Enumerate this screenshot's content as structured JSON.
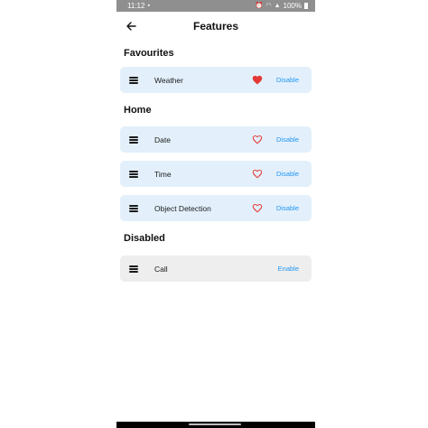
{
  "status_bar": {
    "time": "11:12",
    "battery_text": "100%"
  },
  "app_bar": {
    "title": "Features"
  },
  "colors": {
    "accent": "#2196f3",
    "heart": "#e53935",
    "card_enabled": "#e3f0fb",
    "card_disabled": "#eeeeee"
  },
  "sections": {
    "favourites": {
      "title": "Favourites",
      "items": [
        {
          "label": "Weather",
          "favourite": true,
          "action": "Disable"
        }
      ]
    },
    "home": {
      "title": "Home",
      "items": [
        {
          "label": "Date",
          "favourite": false,
          "action": "Disable"
        },
        {
          "label": "Time",
          "favourite": false,
          "action": "Disable"
        },
        {
          "label": "Object Detection",
          "favourite": false,
          "action": "Disable"
        }
      ]
    },
    "disabled": {
      "title": "Disabled",
      "items": [
        {
          "label": "Call",
          "action": "Enable"
        }
      ]
    }
  }
}
